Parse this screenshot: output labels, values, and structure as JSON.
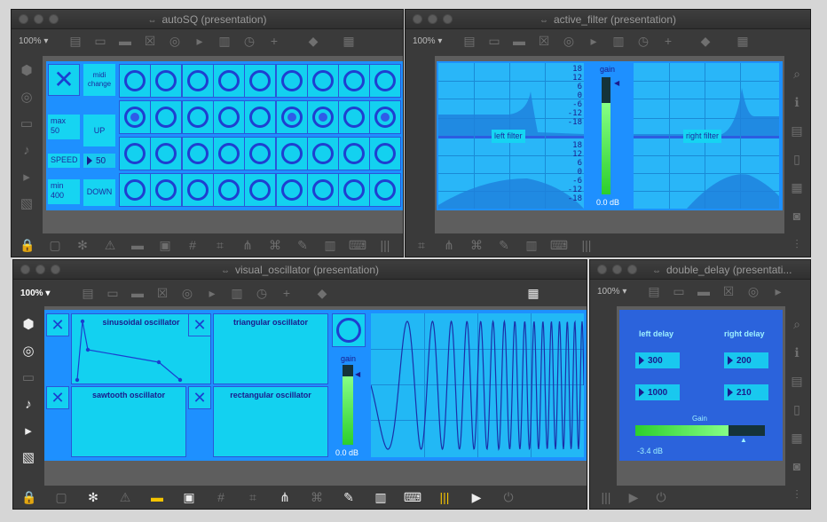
{
  "windows": {
    "autosq": {
      "title": "autoSQ (presentation)",
      "zoom": "100%",
      "midi_change": "midi\nchange",
      "max": "max\n50",
      "up": "UP",
      "speed": "SPEED",
      "speed_value": "50",
      "min": "min\n400",
      "down": "DOWN",
      "grid": [
        [
          0,
          0,
          0,
          0,
          0,
          0,
          0,
          0,
          0
        ],
        [
          1,
          0,
          0,
          0,
          0,
          1,
          1,
          0,
          1
        ],
        [
          0,
          0,
          0,
          0,
          0,
          0,
          0,
          0,
          0
        ],
        [
          0,
          0,
          0,
          0,
          0,
          0,
          0,
          0,
          0
        ]
      ]
    },
    "active_filter": {
      "title": "active_filter (presentation)",
      "zoom": "100%",
      "left_filter": "left filter",
      "right_filter": "right filter",
      "gain": "gain",
      "gain_value": "0.0 dB",
      "ticks_top": [
        "18",
        "12",
        "6",
        "0",
        "-6",
        "-12",
        "-18"
      ],
      "ticks_bottom": [
        "18",
        "12",
        "6",
        "0",
        "-6",
        "-12",
        "-18"
      ]
    },
    "visual_oscillator": {
      "title": "visual_oscillator (presentation)",
      "zoom": "100%",
      "sinusoidal": "sinusoidal oscillator",
      "triangular": "triangular oscillator",
      "sawtooth": "sawtooth oscillator",
      "rectangular": "rectangular oscillator",
      "gain": "gain",
      "gain_value": "0.0 dB"
    },
    "double_delay": {
      "title": "double_delay (presentati...",
      "zoom": "100%",
      "left_delay": "left delay",
      "right_delay": "right delay",
      "left_values": [
        "300",
        "1000"
      ],
      "right_values": [
        "200",
        "210"
      ],
      "gain": "Gain",
      "gain_value": "-3.4 dB"
    }
  },
  "colors": {
    "accent_blue": "#1e90ff",
    "cyan": "#16d4f2",
    "meter_green": "#2ccf2c",
    "highlight_yellow": "#f5c400"
  }
}
